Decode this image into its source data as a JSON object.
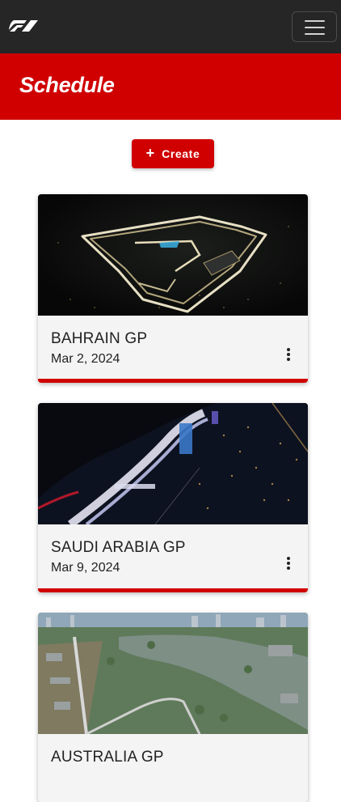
{
  "navbar": {
    "logo_icon": "f1-logo-icon",
    "menu_icon": "hamburger-menu-icon"
  },
  "hero": {
    "title": "Schedule"
  },
  "actions": {
    "create_label": "Create",
    "create_icon": "plus-icon"
  },
  "events": [
    {
      "name": "BAHRAIN GP",
      "date": "Mar 2, 2024",
      "image": "bahrain-circuit-night-aerial",
      "menu_icon": "more-vert-icon"
    },
    {
      "name": "SAUDI ARABIA GP",
      "date": "Mar 9, 2024",
      "image": "jeddah-circuit-night-aerial",
      "menu_icon": "more-vert-icon"
    },
    {
      "name": "AUSTRALIA GP",
      "date": "",
      "image": "melbourne-albert-park-aerial",
      "menu_icon": "more-vert-icon"
    }
  ],
  "colors": {
    "brand_red": "#d00000",
    "navbar": "#262626",
    "card_bg": "#f4f4f4"
  }
}
